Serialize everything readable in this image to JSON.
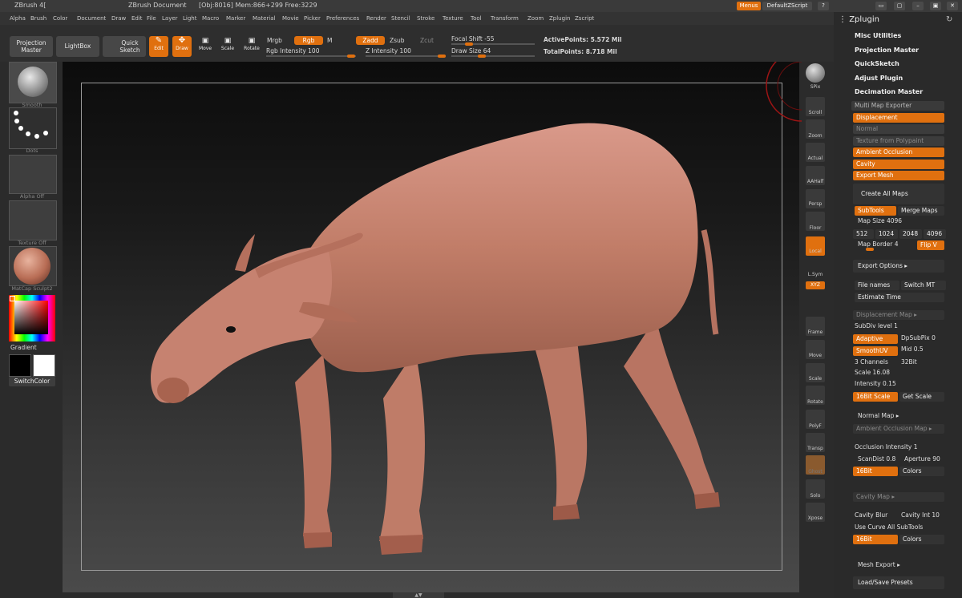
{
  "titlebar": {
    "app": "ZBrush 4[",
    "document": "ZBrush Document",
    "stats": "[Obj:8016] Mem:866+299 Free:3229",
    "menus_btn": "Menus",
    "script_btn": "DefaultZScript"
  },
  "menubar": [
    "Alpha",
    "Brush",
    "Color",
    "Document",
    "Draw",
    "Edit",
    "File",
    "Layer",
    "Light",
    "Macro",
    "Marker",
    "Material",
    "Movie",
    "Picker",
    "Preferences",
    "Render",
    "Stencil",
    "Stroke",
    "Texture",
    "Tool",
    "Transform",
    "Zoom",
    "Zplugin",
    "Zscript"
  ],
  "toolbar": {
    "projection_master": "Projection Master",
    "lightbox": "LightBox",
    "quick_sketch": "Quick Sketch",
    "edit": "Edit",
    "draw": "Draw",
    "move": "Move",
    "scale": "Scale",
    "rotate": "Rotate",
    "mrgb": "Mrgb",
    "rgb": "Rgb",
    "m": "M",
    "zadd": "Zadd",
    "zsub": "Zsub",
    "zcut": "Zcut",
    "rgb_intensity": "Rgb Intensity 100",
    "z_intensity": "Z Intensity 100",
    "focal_shift": "Focal Shift -55",
    "draw_size": "Draw Size 64",
    "active_points": "ActivePoints: 5.572 Mil",
    "total_points": "TotalPoints: 8.718 Mil"
  },
  "leftshelf": {
    "brush": "Smooth",
    "stroke": "Dots",
    "alpha": "Alpha Off",
    "texture": "Texture Off",
    "material": "MatCap Sculpt2",
    "gradient": "Gradient",
    "switchcolor": "SwitchColor"
  },
  "rightshelf": [
    "SPix",
    "Scroll",
    "Zoom",
    "Actual",
    "AAHalf",
    "Persp",
    "Floor",
    "Local",
    "L.Sym",
    "XYZ",
    "Frame",
    "Move",
    "Scale",
    "Rotate",
    "PolyF",
    "Transp",
    "Ghost",
    "Solo",
    "Xpose"
  ],
  "plugin": {
    "title": "Zplugin",
    "items": [
      "Misc Utilities",
      "Projection Master",
      "QuickSketch",
      "Adjust Plugin",
      "Decimation Master"
    ],
    "mme": {
      "header": "Multi Map Exporter",
      "displacement": "Displacement",
      "normal": "Normal",
      "texture_polypaint": "Texture from Polypaint",
      "ambient_occlusion": "Ambient Occlusion",
      "cavity": "Cavity",
      "export_mesh": "Export Mesh",
      "create_all": "Create All Maps",
      "subtools": "SubTools",
      "merge_maps": "Merge Maps",
      "map_size": "Map Size 4096",
      "sizes": [
        "512",
        "1024",
        "2048",
        "4096"
      ],
      "map_border": "Map Border 4",
      "flip_v": "Flip V",
      "export_options": "Export Options ▸",
      "file_names": "File names",
      "switch_mt": "Switch MT",
      "estimate_time": "Estimate Time",
      "displacement_map": "Displacement Map ▸",
      "subdiv_level": "SubDiv level 1",
      "adaptive": "Adaptive",
      "dpsubpix": "DpSubPix 0",
      "smoothuv": "SmoothUV",
      "mid": "Mid 0.5",
      "channels": "3 Channels",
      "bit32": "32Bit",
      "scale": "Scale 16.08",
      "intensity": "Intensity 0.15",
      "bit16scale": "16Bit Scale",
      "get_scale": "Get Scale",
      "normal_map": "Normal Map ▸",
      "ao_map": "Ambient Occlusion Map ▸",
      "occlusion_intensity": "Occlusion Intensity 1",
      "scandist": "ScanDist 0.8",
      "aperture": "Aperture 90",
      "ao_16bit": "16Bit",
      "ao_colors": "Colors",
      "cavity_map": "Cavity Map ▸",
      "cavity_blur": "Cavity Blur",
      "cavity_int": "Cavity Int 10",
      "use_curve": "Use Curve All SubTools",
      "cav_16bit": "16Bit",
      "cav_colors": "Colors",
      "mesh_export": "Mesh Export ▸",
      "load_save": "Load/Save Presets"
    }
  },
  "colors": {
    "accent": "#e0700f",
    "model": "#c17d68"
  }
}
